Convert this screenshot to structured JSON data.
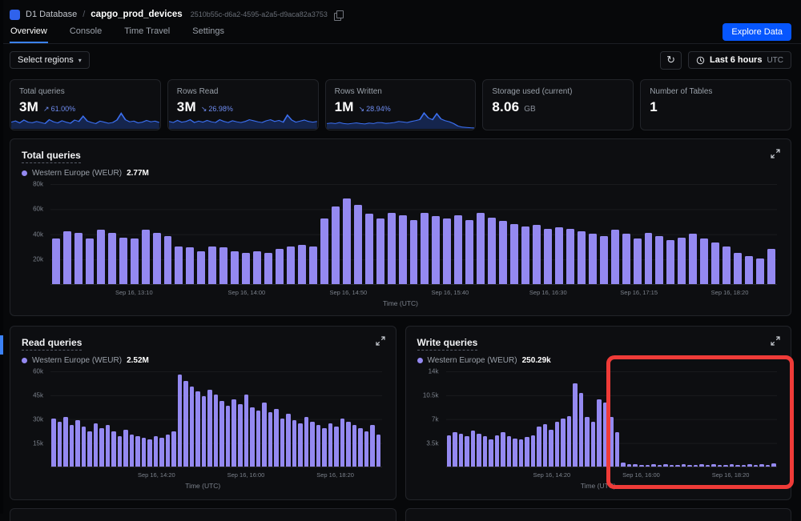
{
  "header": {
    "product": "D1 Database",
    "separator": "/",
    "database_name": "capgo_prod_devices",
    "database_id": "2510b55c-d6a2-4595-a2a5-d9aca82a3753"
  },
  "tabs": [
    {
      "label": "Overview",
      "active": true
    },
    {
      "label": "Console",
      "active": false
    },
    {
      "label": "Time Travel",
      "active": false
    },
    {
      "label": "Settings",
      "active": false
    }
  ],
  "explore_button": "Explore Data",
  "toolbar": {
    "select_regions": "Select regions",
    "time_range": "Last 6 hours",
    "time_zone": "UTC"
  },
  "icons": {
    "caret": "▾",
    "refresh": "↻"
  },
  "colors": {
    "accent_blue": "#0656fe",
    "tab_underline": "#3b82f6",
    "bar_purple": "#9489f1",
    "spark_blue": "#3b6ff0",
    "annotation_red": "#ef3b38"
  },
  "stats": [
    {
      "label": "Total queries",
      "value": "3M",
      "delta_arrow": "↗",
      "delta": "61.00%",
      "spark": [
        0.38,
        0.45,
        0.34,
        0.5,
        0.38,
        0.35,
        0.42,
        0.36,
        0.3,
        0.52,
        0.4,
        0.34,
        0.46,
        0.38,
        0.32,
        0.5,
        0.42,
        0.72,
        0.44,
        0.36,
        0.3,
        0.44,
        0.38,
        0.32,
        0.36,
        0.5,
        0.88,
        0.52,
        0.4,
        0.44,
        0.34,
        0.38,
        0.48,
        0.4,
        0.44,
        0.36
      ]
    },
    {
      "label": "Rows Read",
      "value": "3M",
      "delta_arrow": "↘",
      "delta": "26.98%",
      "spark": [
        0.42,
        0.36,
        0.48,
        0.38,
        0.42,
        0.52,
        0.36,
        0.44,
        0.38,
        0.48,
        0.4,
        0.36,
        0.52,
        0.42,
        0.36,
        0.46,
        0.4,
        0.36,
        0.42,
        0.52,
        0.46,
        0.4,
        0.36,
        0.46,
        0.52,
        0.42,
        0.48,
        0.38,
        0.78,
        0.5,
        0.38,
        0.44,
        0.5,
        0.42,
        0.38,
        0.42
      ]
    },
    {
      "label": "Rows Written",
      "value": "1M",
      "delta_arrow": "↘",
      "delta": "28.94%",
      "spark": [
        0.3,
        0.33,
        0.3,
        0.36,
        0.3,
        0.28,
        0.31,
        0.34,
        0.3,
        0.28,
        0.33,
        0.3,
        0.36,
        0.35,
        0.31,
        0.33,
        0.36,
        0.42,
        0.39,
        0.36,
        0.42,
        0.47,
        0.53,
        0.9,
        0.62,
        0.52,
        0.86,
        0.56,
        0.46,
        0.4,
        0.3,
        0.16,
        0.1,
        0.08,
        0.06,
        0.05
      ]
    },
    {
      "label": "Storage used (current)",
      "value": "8.06",
      "unit": "GB"
    },
    {
      "label": "Number of Tables",
      "value": "1"
    }
  ],
  "charts": {
    "total": {
      "type": "bar",
      "title": "Total queries",
      "legend_region": "Western Europe (WEUR)",
      "legend_value": "2.77M",
      "axis_title": "Time (UTC)",
      "max": 80000,
      "values": [
        36000,
        42000,
        41000,
        36000,
        43000,
        41000,
        37000,
        36000,
        43000,
        41000,
        38000,
        30000,
        29000,
        26000,
        30000,
        29000,
        26000,
        25000,
        26000,
        25000,
        28000,
        30000,
        31000,
        30000,
        52000,
        62000,
        68000,
        63000,
        56000,
        52000,
        57000,
        55000,
        51000,
        57000,
        54000,
        52000,
        55000,
        51000,
        57000,
        53000,
        50000,
        48000,
        46000,
        47000,
        44000,
        45000,
        44000,
        42000,
        40000,
        38000,
        43000,
        40000,
        36000,
        41000,
        38000,
        35000,
        37000,
        40000,
        36000,
        33000,
        30000,
        25000,
        22000,
        20000,
        28000
      ],
      "yticks": [
        {
          "pos": 0,
          "label": "80k"
        },
        {
          "pos": 25,
          "label": "60k"
        },
        {
          "pos": 50,
          "label": "40k"
        },
        {
          "pos": 75,
          "label": "20k"
        }
      ],
      "xticks": [
        {
          "pos": 11.5,
          "label": "Sep 16, 13:10"
        },
        {
          "pos": 27,
          "label": "Sep 16, 14:00"
        },
        {
          "pos": 41,
          "label": "Sep 16, 14:50"
        },
        {
          "pos": 55,
          "label": "Sep 16, 15:40"
        },
        {
          "pos": 68.5,
          "label": "Sep 16, 16:30"
        },
        {
          "pos": 81,
          "label": "Sep 16, 17:15"
        },
        {
          "pos": 93.5,
          "label": "Sep 16, 18:20"
        }
      ]
    },
    "read": {
      "type": "bar",
      "title": "Read queries",
      "legend_region": "Western Europe (WEUR)",
      "legend_value": "2.52M",
      "axis_title": "Time (UTC)",
      "max": 60000,
      "values": [
        30000,
        28000,
        31000,
        26000,
        29000,
        25000,
        22000,
        27000,
        24000,
        26000,
        22000,
        19000,
        23000,
        20000,
        19000,
        18000,
        17000,
        19000,
        18000,
        20000,
        22000,
        58000,
        54000,
        50000,
        47000,
        44000,
        48000,
        45000,
        41000,
        38000,
        42000,
        39000,
        45000,
        37000,
        35000,
        40000,
        34000,
        36000,
        30000,
        33000,
        29000,
        27000,
        31000,
        28000,
        26000,
        24000,
        27000,
        25000,
        30000,
        28000,
        26000,
        24000,
        22000,
        26000,
        20000
      ],
      "yticks": [
        {
          "pos": 0,
          "label": "60k"
        },
        {
          "pos": 25,
          "label": "45k"
        },
        {
          "pos": 50,
          "label": "30k"
        },
        {
          "pos": 75,
          "label": "15k"
        }
      ],
      "xticks": [
        {
          "pos": 32,
          "label": "Sep 16, 14:20"
        },
        {
          "pos": 59,
          "label": "Sep 16, 16:00"
        },
        {
          "pos": 86,
          "label": "Sep 16, 18:20"
        }
      ]
    },
    "write": {
      "type": "bar",
      "title": "Write queries",
      "legend_region": "Western Europe (WEUR)",
      "legend_value": "250.29k",
      "axis_title": "Time (UTC)",
      "max": 14000,
      "values": [
        4600,
        5000,
        4800,
        4400,
        5200,
        4800,
        4400,
        4000,
        4600,
        5000,
        4400,
        4100,
        3900,
        4300,
        4600,
        5800,
        6200,
        5400,
        6600,
        7000,
        7400,
        12200,
        10800,
        7200,
        6600,
        9800,
        9400,
        7200,
        5000,
        500,
        300,
        250,
        200,
        200,
        300,
        200,
        250,
        200,
        200,
        300,
        200,
        200,
        250,
        200,
        300,
        200,
        200,
        250,
        200,
        200,
        300,
        200,
        250,
        200,
        400
      ],
      "yticks": [
        {
          "pos": 0,
          "label": "14k"
        },
        {
          "pos": 25,
          "label": "10.5k"
        },
        {
          "pos": 50,
          "label": "7k"
        },
        {
          "pos": 75,
          "label": "3.5k"
        }
      ],
      "xticks": [
        {
          "pos": 32,
          "label": "Sep 16, 14:20"
        },
        {
          "pos": 59,
          "label": "Sep 16, 16:00"
        },
        {
          "pos": 86,
          "label": "Sep 16, 18:20"
        }
      ]
    }
  },
  "annotation": {
    "shape": "rectangle",
    "color": "#ef3b38"
  }
}
